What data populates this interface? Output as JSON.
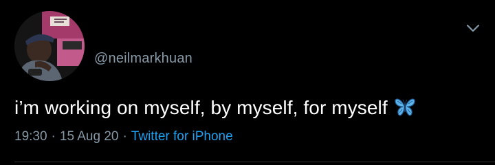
{
  "author": {
    "handle": "@neilmarkhuan",
    "avatar_icon": "profile-photo"
  },
  "tweet": {
    "text": "i’m working on myself, by myself, for myself",
    "emoji_icon": "blue-butterfly-emoji"
  },
  "meta": {
    "time": "19:30",
    "separator": "·",
    "date": "15 Aug 20",
    "source": "Twitter for iPhone"
  },
  "colors": {
    "background": "#000000",
    "text": "#ffffff",
    "secondary": "#8899a6",
    "link": "#1da1f2",
    "butterfly": "#4aa3df"
  }
}
